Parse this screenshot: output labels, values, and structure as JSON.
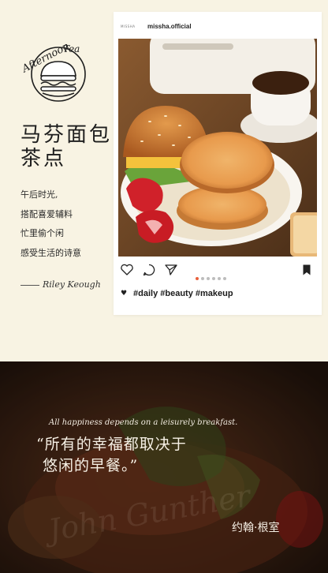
{
  "left_panel": {
    "logo_text": "Afternoon Tea",
    "title_lines": [
      "马芬面包",
      "茶点"
    ],
    "poem_lines": [
      "午后时光,",
      "搭配喜爱辅料",
      "忙里偷个闲",
      "感受生活的诗意"
    ],
    "signature": "Riley Keough"
  },
  "post_card": {
    "brand_mini": "MISSHA",
    "account": "missha.official",
    "carousel": {
      "total": 6,
      "active_index": 0
    },
    "hashtags": "#daily #beauty #makeup",
    "icons": {
      "like": "heart-icon",
      "comment": "comment-icon",
      "share": "send-icon",
      "save": "bookmark-icon"
    }
  },
  "quote_banner": {
    "english": "All happiness depends on a leisurely breakfast.",
    "chinese_lines": [
      "“所有的幸福都取决于",
      "悠闲的早餐。”"
    ],
    "author_zh": "约翰·根室",
    "author_watermark": "John Gunther"
  },
  "colors": {
    "background": "#f8f3e3",
    "dark_banner": "#2e1c12",
    "carousel_active": "#e8603c"
  }
}
